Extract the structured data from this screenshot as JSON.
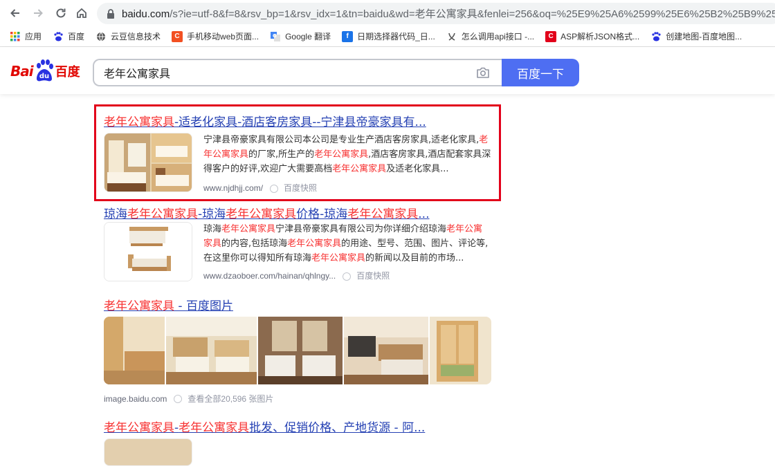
{
  "browser": {
    "url_host": "baidu.com",
    "url_rest": "/s?ie=utf-8&f=8&rsv_bp=1&rsv_idx=1&tn=baidu&wd=老年公寓家具&fenlei=256&oq=%25E9%25A6%2599%25E6%25B2%25B9%25",
    "bookmarks": [
      {
        "label": "应用",
        "icon": "apps-grid-icon",
        "color": "#4285f4"
      },
      {
        "label": "百度",
        "icon": "baidu-paw-icon",
        "color": "#2932e1"
      },
      {
        "label": "云豆信息技术",
        "icon": "globe-icon",
        "color": "#555555"
      },
      {
        "label": "手机移动web页面...",
        "icon": "c-logo-icon",
        "color": "#f25022"
      },
      {
        "label": "Google 翻译",
        "icon": "translate-icon",
        "color": "#4285f4"
      },
      {
        "label": "日期选择器代码_日...",
        "icon": "f-logo-icon",
        "color": "#1a73e8"
      },
      {
        "label": "怎么调用api接口 -...",
        "icon": "zhihu-logo-icon",
        "color": "#555555"
      },
      {
        "label": "ASP解析JSON格式...",
        "icon": "c-logo-icon",
        "color": "#e2001a"
      },
      {
        "label": "创建地图-百度地图...",
        "icon": "baidu-paw-icon",
        "color": "#2932e1"
      }
    ]
  },
  "baidu": {
    "logo_text_en": "Bai",
    "logo_text_du": "du",
    "logo_text_cn": "百度",
    "query": "老年公寓家具",
    "search_button": "百度一下"
  },
  "results": [
    {
      "title_parts": [
        {
          "t": "老年公寓家具",
          "em": true
        },
        {
          "t": "-适老化家具-酒店客房家具--宁津县帝豪家具有...",
          "em": false
        }
      ],
      "snippet_parts": [
        {
          "t": "宁津县帝豪家具有限公司本公司是专业生产酒店客房家具,适老化家具,",
          "em": false
        },
        {
          "t": "老年公寓家具",
          "em": true
        },
        {
          "t": "的厂家,所生产的",
          "em": false
        },
        {
          "t": "老年公寓家具",
          "em": true
        },
        {
          "t": ",酒店客房家具,酒店配套家具深得客户的好评,欢迎广大需要高档",
          "em": false
        },
        {
          "t": "老年公寓家具",
          "em": true
        },
        {
          "t": "及适老化家具...",
          "em": false
        }
      ],
      "url": "www.njdhjj.com/",
      "snapshot": "百度快照"
    },
    {
      "title_parts": [
        {
          "t": "琼海",
          "em": false
        },
        {
          "t": "老年公寓家具",
          "em": true
        },
        {
          "t": "-琼海",
          "em": false
        },
        {
          "t": "老年公寓家具",
          "em": true
        },
        {
          "t": "价格-琼海",
          "em": false
        },
        {
          "t": "老年公寓家具",
          "em": true
        },
        {
          "t": "...",
          "em": false
        }
      ],
      "snippet_parts": [
        {
          "t": "琼海",
          "em": false
        },
        {
          "t": "老年公寓家具",
          "em": true
        },
        {
          "t": "宁津县帝豪家具有限公司为你详细介绍琼海",
          "em": false
        },
        {
          "t": "老年公寓家具",
          "em": true
        },
        {
          "t": "的内容,包括琼海",
          "em": false
        },
        {
          "t": "老年公寓家具",
          "em": true
        },
        {
          "t": "的用途、型号、范围、图片、评论等,在这里你可以得知所有琼海",
          "em": false
        },
        {
          "t": "老年公寓家具",
          "em": true
        },
        {
          "t": "的新闻以及目前的市场...",
          "em": false
        }
      ],
      "url": "www.dzaoboer.com/hainan/qhlngy...",
      "snapshot": "百度快照"
    },
    {
      "title_parts": [
        {
          "t": "老年公寓家具",
          "em": true
        },
        {
          "t": " - 百度图片",
          "em": false
        }
      ],
      "url": "image.baidu.com",
      "view_all": "查看全部20,596 张图片"
    },
    {
      "title_parts": [
        {
          "t": "老年公寓家具",
          "em": true
        },
        {
          "t": "-",
          "em": false
        },
        {
          "t": "老年公寓家具",
          "em": true
        },
        {
          "t": "批发、促销价格、产地货源 - 阿...",
          "em": false
        }
      ]
    }
  ],
  "colors": {
    "link": "#2440b3",
    "highlight": "#f73131",
    "button": "#4e6ef2",
    "annotation_box": "#e2001a"
  }
}
